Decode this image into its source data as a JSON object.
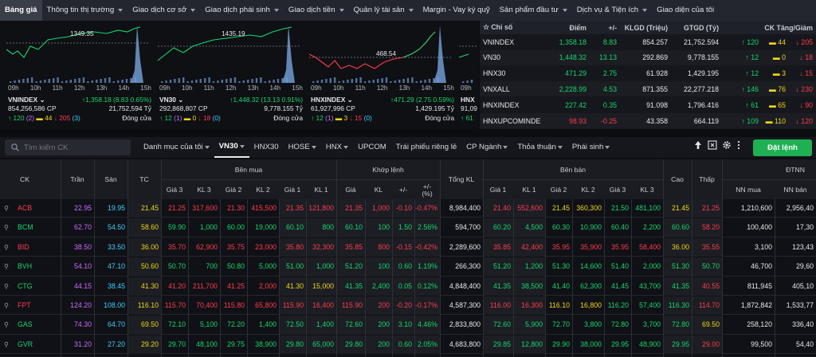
{
  "nav": {
    "items": [
      {
        "label": "Bảng giá",
        "active": true,
        "caret": false
      },
      {
        "label": "Thông tin thị trường",
        "caret": true
      },
      {
        "label": "Giao dịch cơ sở",
        "caret": true
      },
      {
        "label": "Giao dịch phái sinh",
        "caret": true
      },
      {
        "label": "Giao dịch tiền",
        "caret": true
      },
      {
        "label": "Quản lý tài sản",
        "caret": true
      },
      {
        "label": "Margin - Vay ký quỹ",
        "caret": false
      },
      {
        "label": "Sản phẩm đầu tư",
        "caret": true
      },
      {
        "label": "Dịch vụ & Tiện ích",
        "caret": true
      },
      {
        "label": "Giao diện của tôi",
        "caret": false
      }
    ]
  },
  "mini_charts": [
    {
      "peak_label": "1349.35",
      "times": [
        "09h",
        "10h",
        "11h",
        "12h",
        "13h",
        "14h",
        "15h"
      ],
      "name": "VNINDEX",
      "change": "↑1,358.18 (8.83 0.65%)",
      "volume": "854,256,586 CP",
      "value": "21,752,594 Tỷ",
      "up": "↑ 120",
      "up_ceil": "(2)",
      "flat": "44",
      "down": "↓ 205",
      "down_floor": "(3)",
      "status": "Đóng cửa"
    },
    {
      "peak_label": "1435.19",
      "times": [
        "09h",
        "10h",
        "11h",
        "12h",
        "13h",
        "14h",
        "15h"
      ],
      "name": "VN30",
      "change": "↑1,448.32 (13.13 0.91%)",
      "volume": "292,868,807 CP",
      "value": "9,778.155 Tỷ",
      "up": "↑ 12",
      "up_ceil": "(1)",
      "flat": "0",
      "down": "↓ 18",
      "down_floor": "(0)",
      "status": "Đóng cửa"
    },
    {
      "peak_label": "468.54",
      "times": [
        "09h",
        "10h",
        "11h",
        "12h",
        "13h",
        "14h",
        "15h"
      ],
      "name": "HNXINDEX",
      "change": "↑471.29 (2.75 0.59%)",
      "volume": "61,927,996 CP",
      "value": "1,429.195 Tỷ",
      "up": "↑ 12",
      "up_ceil": "(1)",
      "flat": "3",
      "down": "↓ 15",
      "down_floor": "(0)",
      "status": "Đóng cửa"
    },
    {
      "peak_label": "",
      "times": [
        "09h"
      ],
      "name": "HNX",
      "change": "",
      "volume": "91,09",
      "value": "",
      "up": "↑ 61",
      "up_ceil": "",
      "flat": "",
      "down": "",
      "down_floor": "",
      "status": ""
    }
  ],
  "index_table": {
    "headers": [
      "Chỉ số",
      "Điểm",
      "+/-",
      "KLGD (Triệu)",
      "GTGD (Tỷ)",
      "CK Tăng/Giảm"
    ],
    "rows": [
      {
        "name": "VNINDEX",
        "point": "1,358.18",
        "change": "8.83",
        "vol": "854.257",
        "val": "21,752.594",
        "up": "↑ 120",
        "flat": "44",
        "down": "↓ 205",
        "color": "g"
      },
      {
        "name": "VN30",
        "point": "1,448.32",
        "change": "13.13",
        "vol": "292.869",
        "val": "9,778.155",
        "up": "↑ 12",
        "flat": "0",
        "down": "↓ 18",
        "color": "g"
      },
      {
        "name": "HNX30",
        "point": "471.29",
        "change": "2.75",
        "vol": "61.928",
        "val": "1,429.195",
        "up": "↑ 12",
        "flat": "3",
        "down": "↓ 15",
        "color": "g"
      },
      {
        "name": "VNXALL",
        "point": "2,228.99",
        "change": "4.53",
        "vol": "871.355",
        "val": "22,277.218",
        "up": "↑ 146",
        "flat": "76",
        "down": "↓ 230",
        "color": "g"
      },
      {
        "name": "HNXINDEX",
        "point": "227.42",
        "change": "0.35",
        "vol": "91.098",
        "val": "1,796.416",
        "up": "↑ 61",
        "flat": "65",
        "down": "↓ 90",
        "color": "g"
      },
      {
        "name": "HNXUPCOMINDE",
        "point": "98.93",
        "change": "-0.25",
        "vol": "43.358",
        "val": "664.119",
        "up": "↑ 109",
        "flat": "110",
        "down": "↓ 120",
        "color": "r"
      }
    ]
  },
  "toolbar": {
    "search_placeholder": "Tìm kiếm CK",
    "tabs": [
      {
        "label": "Danh mục của tôi",
        "caret": true
      },
      {
        "label": "VN30",
        "caret": true,
        "active": true
      },
      {
        "label": "HNX30",
        "caret": false
      },
      {
        "label": "HOSE",
        "caret": true
      },
      {
        "label": "HNX",
        "caret": true
      },
      {
        "label": "UPCOM",
        "caret": false
      },
      {
        "label": "Trái phiếu riêng lẻ",
        "caret": false
      },
      {
        "label": "CP Ngành",
        "caret": true
      },
      {
        "label": "Thỏa thuận",
        "caret": true
      },
      {
        "label": "Phái sinh",
        "caret": true
      }
    ],
    "order_button": "Đặt lệnh"
  },
  "board": {
    "groups": {
      "buy": "Bên mua",
      "match": "Khớp lệnh",
      "sell": "Bên bán",
      "foreign": "ĐTNN"
    },
    "cols": {
      "ck": "CK",
      "tran": "Trần",
      "san": "Sàn",
      "tc": "TC",
      "gia3": "Giá 3",
      "kl3": "KL 3",
      "gia2": "Giá 2",
      "kl2": "KL 2",
      "gia1": "Giá 1",
      "kl1": "KL 1",
      "mgia": "Giá",
      "mkl": "KL",
      "mchg": "+/-",
      "mpct": "+/-",
      "mpct2": "(%)",
      "tongkl": "Tổng KL",
      "sgia1": "Giá 1",
      "skl1": "KL 1",
      "sgia2": "Giá 2",
      "skl2": "KL 2",
      "sgia3": "Giá 3",
      "skl3": "KL 3",
      "cao": "Cao",
      "thap": "Thấp",
      "nnmua": "NN mua",
      "nnban": "NN bán"
    },
    "rows": [
      {
        "sym": "ACB",
        "s": "r",
        "v": [
          "22.95",
          "19.95",
          "21.45",
          "21.25",
          "317,600",
          "21.30",
          "415,500",
          "21.35",
          "121,800",
          "21.35",
          "1,000",
          "-0.10",
          "-0.47%",
          "8,984,400",
          "21.40",
          "552,600",
          "21.45",
          "360,300",
          "21.50",
          "481,100",
          "21.45",
          "21.25",
          "1,210,600",
          "2,956,40"
        ],
        "c": [
          "p",
          "c",
          "y",
          "r",
          "r",
          "r",
          "r",
          "r",
          "r",
          "r",
          "r",
          "r",
          "r",
          "w",
          "r",
          "r",
          "y",
          "y",
          "g",
          "g",
          "y",
          "r",
          "w",
          "w"
        ]
      },
      {
        "sym": "BCM",
        "s": "g",
        "v": [
          "62.70",
          "54.50",
          "58.60",
          "59.90",
          "1,000",
          "60.00",
          "19,000",
          "60.10",
          "800",
          "60.10",
          "100",
          "1.50",
          "2.56%",
          "594,700",
          "60.20",
          "4,500",
          "60.30",
          "10,900",
          "60.40",
          "2,200",
          "60.60",
          "58.20",
          "100,400",
          "17,30"
        ],
        "c": [
          "p",
          "c",
          "y",
          "g",
          "g",
          "g",
          "g",
          "g",
          "g",
          "g",
          "g",
          "g",
          "g",
          "w",
          "g",
          "g",
          "g",
          "g",
          "g",
          "g",
          "g",
          "r",
          "w",
          "w"
        ]
      },
      {
        "sym": "BID",
        "s": "r",
        "v": [
          "38.50",
          "33.50",
          "36.00",
          "35.70",
          "62,900",
          "35.75",
          "23,000",
          "35.80",
          "32,300",
          "35.85",
          "800",
          "-0.15",
          "-0.42%",
          "2,289,600",
          "35.85",
          "42,400",
          "35.95",
          "35,900",
          "35.95",
          "58,400",
          "36.00",
          "35.55",
          "3,100",
          "123,43"
        ],
        "c": [
          "p",
          "c",
          "y",
          "r",
          "r",
          "r",
          "r",
          "r",
          "r",
          "r",
          "r",
          "r",
          "r",
          "w",
          "r",
          "r",
          "r",
          "r",
          "r",
          "r",
          "y",
          "r",
          "w",
          "w"
        ]
      },
      {
        "sym": "BVH",
        "s": "g",
        "v": [
          "54.10",
          "47.10",
          "50.60",
          "50.70",
          "700",
          "50.80",
          "5,000",
          "51.00",
          "1,000",
          "51.20",
          "100",
          "0.60",
          "1.19%",
          "266,300",
          "51.20",
          "1,200",
          "51.30",
          "14,600",
          "51.40",
          "2,000",
          "51.30",
          "50.70",
          "46,700",
          "29,60"
        ],
        "c": [
          "p",
          "c",
          "y",
          "g",
          "g",
          "g",
          "g",
          "g",
          "g",
          "g",
          "g",
          "g",
          "g",
          "w",
          "g",
          "g",
          "g",
          "g",
          "g",
          "g",
          "g",
          "g",
          "w",
          "w"
        ]
      },
      {
        "sym": "CTG",
        "s": "g",
        "v": [
          "44.15",
          "38.45",
          "41.30",
          "41.20",
          "211,700",
          "41.25",
          "2,000",
          "41.30",
          "15,000",
          "41.35",
          "2,400",
          "0.05",
          "0.12%",
          "4,848,400",
          "41.35",
          "38,500",
          "41.40",
          "62,300",
          "41.45",
          "43,700",
          "41.35",
          "40.55",
          "811,945",
          "405,10"
        ],
        "c": [
          "p",
          "c",
          "y",
          "r",
          "r",
          "r",
          "r",
          "y",
          "y",
          "g",
          "g",
          "g",
          "g",
          "w",
          "g",
          "g",
          "g",
          "g",
          "g",
          "g",
          "g",
          "r",
          "w",
          "w"
        ]
      },
      {
        "sym": "FPT",
        "s": "r",
        "v": [
          "124.20",
          "108.00",
          "116.10",
          "115.70",
          "70,400",
          "115.80",
          "65,800",
          "115.90",
          "16,400",
          "115.90",
          "200",
          "-0.20",
          "-0.17%",
          "4,587,300",
          "116.00",
          "16,300",
          "116.10",
          "16,800",
          "116.20",
          "57,400",
          "116.30",
          "114.70",
          "1,872,842",
          "1,533,77"
        ],
        "c": [
          "p",
          "c",
          "y",
          "r",
          "r",
          "r",
          "r",
          "r",
          "r",
          "r",
          "r",
          "r",
          "r",
          "w",
          "r",
          "r",
          "y",
          "y",
          "g",
          "g",
          "g",
          "r",
          "w",
          "w"
        ]
      },
      {
        "sym": "GAS",
        "s": "g",
        "v": [
          "74.30",
          "64.70",
          "69.50",
          "72.10",
          "5,100",
          "72.20",
          "1,400",
          "72.50",
          "1,400",
          "72.60",
          "200",
          "3.10",
          "4.46%",
          "2,833,800",
          "72.60",
          "5,900",
          "72.70",
          "3,800",
          "72.80",
          "3,700",
          "72.80",
          "69.50",
          "258,120",
          "336,40"
        ],
        "c": [
          "p",
          "c",
          "y",
          "g",
          "g",
          "g",
          "g",
          "g",
          "g",
          "g",
          "g",
          "g",
          "g",
          "w",
          "g",
          "g",
          "g",
          "g",
          "g",
          "g",
          "g",
          "y",
          "w",
          "w"
        ]
      },
      {
        "sym": "GVR",
        "s": "g",
        "v": [
          "31.20",
          "27.20",
          "29.20",
          "29.70",
          "48,100",
          "29.75",
          "38,900",
          "29.80",
          "65,000",
          "29.80",
          "200",
          "0.60",
          "2.05%",
          "4,683,800",
          "29.85",
          "12,800",
          "29.90",
          "38,000",
          "29.95",
          "48,900",
          "29.95",
          "29.00",
          "99,500",
          "54,40"
        ],
        "c": [
          "p",
          "c",
          "y",
          "g",
          "g",
          "g",
          "g",
          "g",
          "g",
          "g",
          "g",
          "g",
          "g",
          "w",
          "g",
          "g",
          "g",
          "g",
          "g",
          "g",
          "g",
          "r",
          "w",
          "w"
        ]
      }
    ]
  }
}
